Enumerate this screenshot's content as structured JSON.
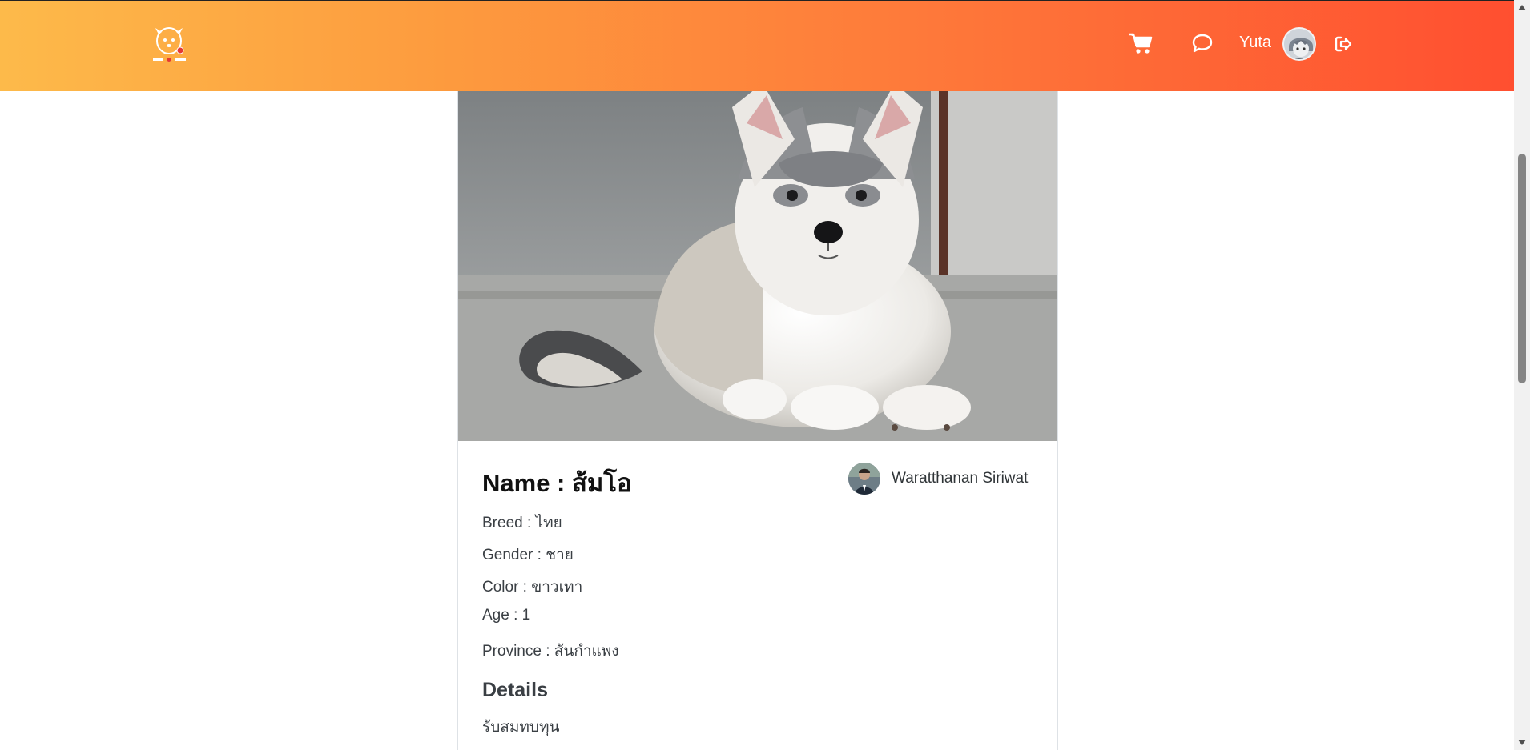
{
  "navbar": {
    "logo_icon": "pet-house-logo",
    "cart_icon": "cart-icon",
    "chat_icon": "chat-icon",
    "username": "Yuta",
    "logout_icon": "logout-icon",
    "colors": {
      "gradient_start": "#fdba4a",
      "gradient_end": "#ff4f30"
    }
  },
  "pet": {
    "photo": "husky-puppy-photo",
    "name_label": "Name : ส้มโอ",
    "owner_name": "Waratthanan Siriwat",
    "breed": "Breed : ไทย",
    "gender": "Gender : ชาย",
    "color": "Color : ขาวเทา",
    "age": "Age : 1",
    "province": "Province : สันกำแพง",
    "details_heading": "Details",
    "details_text": "รับสมทบทุน"
  }
}
